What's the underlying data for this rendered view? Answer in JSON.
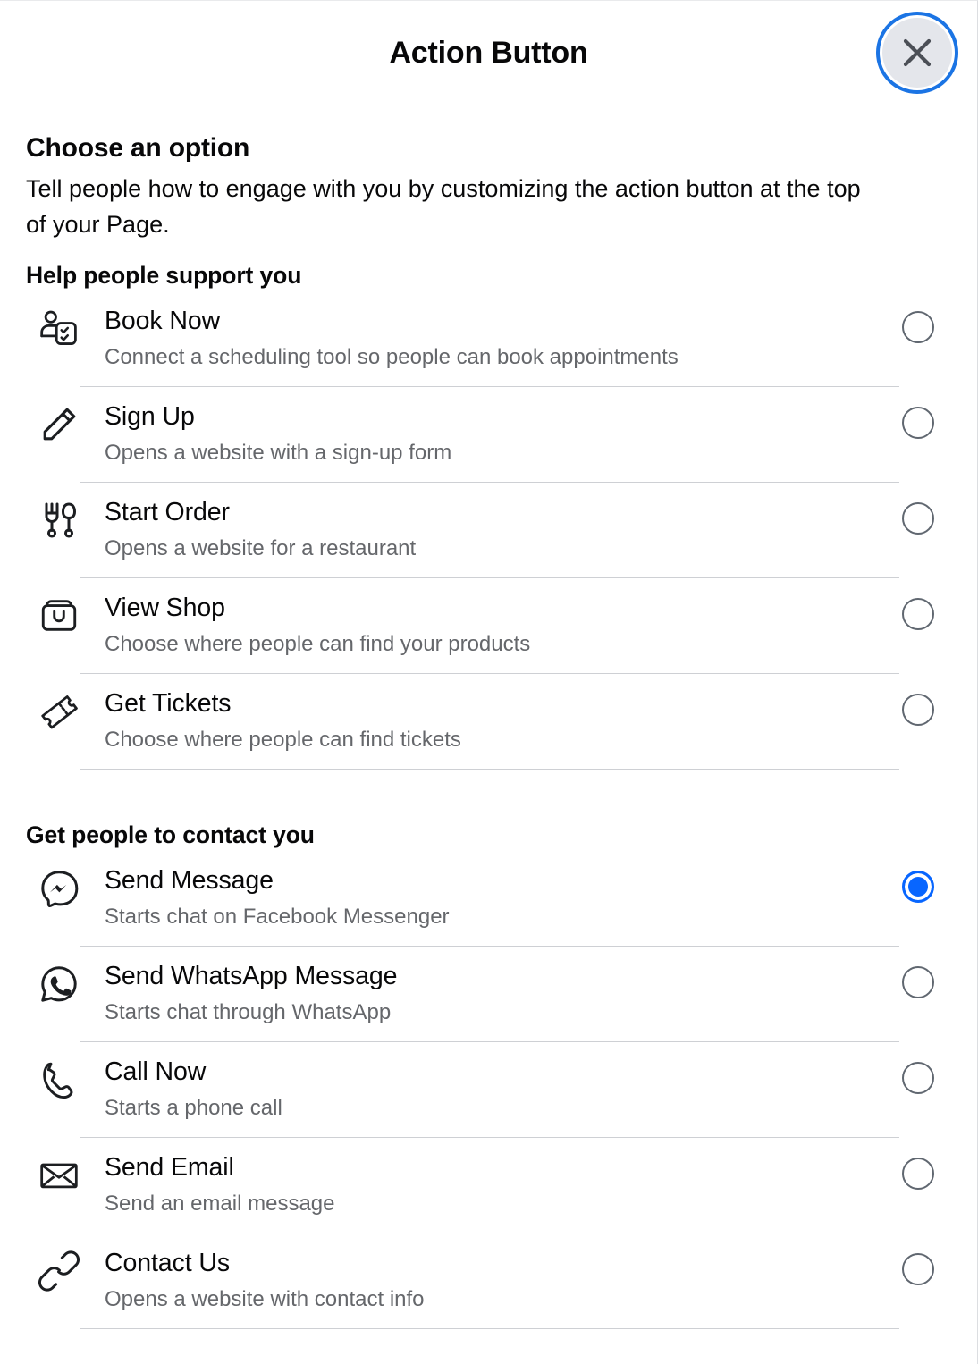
{
  "header": {
    "title": "Action Button",
    "close_icon": "close-icon"
  },
  "content": {
    "heading": "Choose an option",
    "description": "Tell people how to engage with you by customizing the action button at the top of your Page.",
    "groups": [
      {
        "title": "Help people support you",
        "options": [
          {
            "icon": "appointment-person-icon",
            "label": "Book Now",
            "description": "Connect a scheduling tool so people can book appointments",
            "selected": false
          },
          {
            "icon": "pencil-icon",
            "label": "Sign Up",
            "description": "Opens a website with a sign-up form",
            "selected": false
          },
          {
            "icon": "fork-knife-icon",
            "label": "Start Order",
            "description": "Opens a website for a restaurant",
            "selected": false
          },
          {
            "icon": "shopping-bag-icon",
            "label": "View Shop",
            "description": "Choose where people can find your products",
            "selected": false
          },
          {
            "icon": "ticket-icon",
            "label": "Get Tickets",
            "description": "Choose where people can find tickets",
            "selected": false
          }
        ]
      },
      {
        "title": "Get people to contact you",
        "options": [
          {
            "icon": "messenger-icon",
            "label": "Send Message",
            "description": "Starts chat on Facebook Messenger",
            "selected": true
          },
          {
            "icon": "whatsapp-icon",
            "label": "Send WhatsApp Message",
            "description": "Starts chat through WhatsApp",
            "selected": false
          },
          {
            "icon": "phone-icon",
            "label": "Call Now",
            "description": "Starts a phone call",
            "selected": false
          },
          {
            "icon": "envelope-icon",
            "label": "Send Email",
            "description": "Send an email message",
            "selected": false
          },
          {
            "icon": "link-icon",
            "label": "Contact Us",
            "description": "Opens a website with contact info",
            "selected": false
          }
        ]
      }
    ]
  },
  "colors": {
    "accent": "#0866ff",
    "focus_ring": "#1b74e4",
    "text_primary": "#080809",
    "text_secondary": "#65676b",
    "divider": "#ced0d4",
    "close_bg": "#e4e6eb"
  }
}
